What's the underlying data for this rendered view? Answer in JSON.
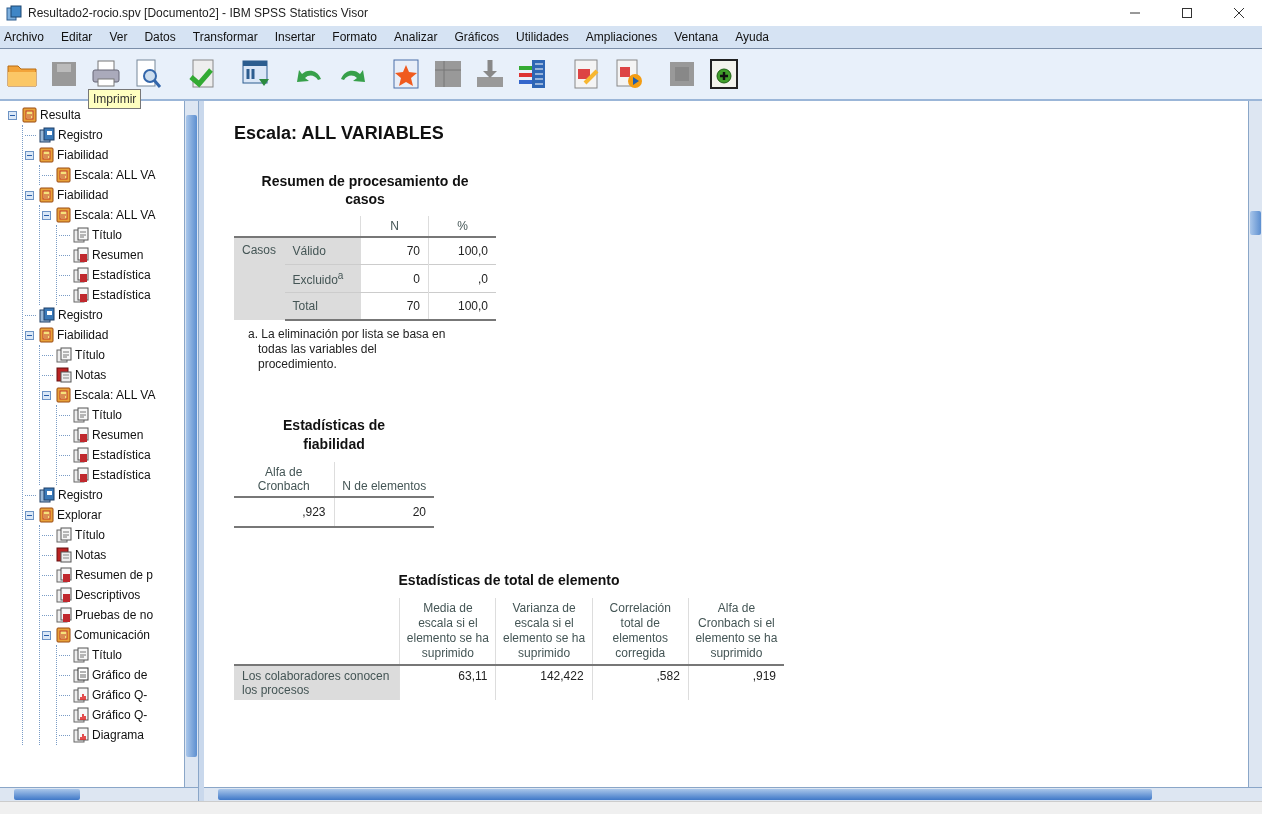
{
  "window": {
    "title": "Resultado2-rocio.spv [Documento2] - IBM SPSS Statistics Visor"
  },
  "menu": [
    "Archivo",
    "Editar",
    "Ver",
    "Datos",
    "Transformar",
    "Insertar",
    "Formato",
    "Analizar",
    "Gráficos",
    "Utilidades",
    "Ampliaciones",
    "Ventana",
    "Ayuda"
  ],
  "toolbar": {
    "tooltip": "Imprimir"
  },
  "outline": [
    {
      "label": "Resulta",
      "kind": "book",
      "expanded": true,
      "children": [
        {
          "label": "Registro",
          "kind": "log"
        },
        {
          "label": "Fiabilidad",
          "kind": "book",
          "expanded": true,
          "children": [
            {
              "label": "Escala: ALL VA",
              "kind": "book"
            }
          ]
        },
        {
          "label": "Fiabilidad",
          "kind": "book",
          "expanded": true,
          "children": [
            {
              "label": "Escala: ALL VA",
              "kind": "book",
              "expanded": true,
              "children": [
                {
                  "label": "Título",
                  "kind": "title"
                },
                {
                  "label": "Resumen",
                  "kind": "table"
                },
                {
                  "label": "Estadística",
                  "kind": "table"
                },
                {
                  "label": "Estadística",
                  "kind": "table"
                }
              ]
            }
          ]
        },
        {
          "label": "Registro",
          "kind": "log"
        },
        {
          "label": "Fiabilidad",
          "kind": "book",
          "expanded": true,
          "children": [
            {
              "label": "Título",
              "kind": "title"
            },
            {
              "label": "Notas",
              "kind": "notes"
            },
            {
              "label": "Escala: ALL VA",
              "kind": "book",
              "expanded": true,
              "children": [
                {
                  "label": "Título",
                  "kind": "title"
                },
                {
                  "label": "Resumen",
                  "kind": "table"
                },
                {
                  "label": "Estadística",
                  "kind": "table"
                },
                {
                  "label": "Estadística",
                  "kind": "table"
                }
              ]
            }
          ]
        },
        {
          "label": "Registro",
          "kind": "log"
        },
        {
          "label": "Explorar",
          "kind": "book",
          "expanded": true,
          "children": [
            {
              "label": "Título",
              "kind": "title"
            },
            {
              "label": "Notas",
              "kind": "notes"
            },
            {
              "label": "Resumen de p",
              "kind": "table"
            },
            {
              "label": "Descriptivos",
              "kind": "table"
            },
            {
              "label": "Pruebas de no",
              "kind": "table"
            },
            {
              "label": "Comunicación",
              "kind": "book",
              "expanded": true,
              "children": [
                {
                  "label": "Título",
                  "kind": "title"
                },
                {
                  "label": "Gráfico de",
                  "kind": "graphic"
                },
                {
                  "label": "Gráfico Q-",
                  "kind": "chart"
                },
                {
                  "label": "Gráfico Q-",
                  "kind": "chart"
                },
                {
                  "label": "Diagrama",
                  "kind": "chart"
                }
              ]
            }
          ]
        }
      ]
    }
  ],
  "output": {
    "heading": "Escala: ALL VARIABLES",
    "case_summary": {
      "title": "Resumen de procesamiento de casos",
      "columns": [
        "N",
        "%"
      ],
      "group": "Casos",
      "rows": [
        {
          "label": "Válido",
          "values": [
            "70",
            "100,0"
          ]
        },
        {
          "label": "Excluido$^{a}$",
          "values": [
            "0",
            ",0"
          ]
        },
        {
          "label": "Total",
          "values": [
            "70",
            "100,0"
          ]
        }
      ],
      "footnote": "a. La eliminación por lista se basa en todas las variables del procedimiento."
    },
    "reliability": {
      "title": "Estadísticas de fiabilidad",
      "columns": [
        "Alfa de Cronbach",
        "N de elementos"
      ],
      "values": [
        ",923",
        "20"
      ]
    },
    "item_total": {
      "title": "Estadísticas de total de elemento",
      "columns": [
        "Media de escala si el elemento se ha suprimido",
        "Varianza de escala si el elemento se ha suprimido",
        "Correlación total de elementos corregida",
        "Alfa de Cronbach si el elemento se ha suprimido"
      ],
      "rows": [
        {
          "label": "Los colaboradores conocen los procesos",
          "values": [
            "63,11",
            "142,422",
            ",582",
            ",919"
          ]
        }
      ]
    }
  }
}
